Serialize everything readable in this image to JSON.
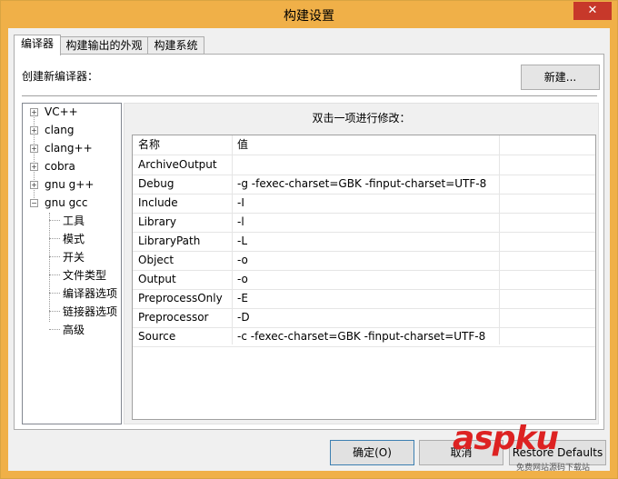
{
  "window": {
    "title": "构建设置",
    "close_glyph": "✕"
  },
  "tabs": [
    {
      "label": "编译器",
      "active": true
    },
    {
      "label": "构建输出的外观",
      "active": false
    },
    {
      "label": "构建系统",
      "active": false
    }
  ],
  "compiler_page": {
    "create_label": "创建新编译器：",
    "new_button": "新建...",
    "hint": "双击一项进行修改："
  },
  "tree": {
    "roots": [
      {
        "label": "VC++",
        "expander": "+"
      },
      {
        "label": "clang",
        "expander": "+"
      },
      {
        "label": "clang++",
        "expander": "+"
      },
      {
        "label": "cobra",
        "expander": "+"
      },
      {
        "label": "gnu g++",
        "expander": "+"
      },
      {
        "label": "gnu gcc",
        "expander": "−"
      }
    ],
    "children": [
      {
        "label": "工具"
      },
      {
        "label": "模式"
      },
      {
        "label": "开关"
      },
      {
        "label": "文件类型"
      },
      {
        "label": "编译器选项"
      },
      {
        "label": "链接器选项"
      },
      {
        "label": "高级"
      }
    ]
  },
  "grid": {
    "headers": {
      "name": "名称",
      "value": "值"
    },
    "rows": [
      {
        "name": "ArchiveOutput",
        "value": ""
      },
      {
        "name": "Debug",
        "value": "-g -fexec-charset=GBK -finput-charset=UTF-8"
      },
      {
        "name": "Include",
        "value": "-I"
      },
      {
        "name": "Library",
        "value": "-l"
      },
      {
        "name": "LibraryPath",
        "value": "-L"
      },
      {
        "name": "Object",
        "value": "-o"
      },
      {
        "name": "Output",
        "value": "-o"
      },
      {
        "name": "PreprocessOnly",
        "value": "-E"
      },
      {
        "name": "Preprocessor",
        "value": "-D"
      },
      {
        "name": "Source",
        "value": "-c -fexec-charset=GBK -finput-charset=UTF-8"
      }
    ]
  },
  "footer": {
    "ok": "确定(O)",
    "cancel": "取消",
    "defaults": "Restore Defaults"
  },
  "watermark": {
    "brand": "aspku",
    "sub": "免费网站源码下载站"
  },
  "colors": {
    "title_bar": "#f0b048",
    "close": "#c7382a",
    "watermark": "#dd2222"
  }
}
